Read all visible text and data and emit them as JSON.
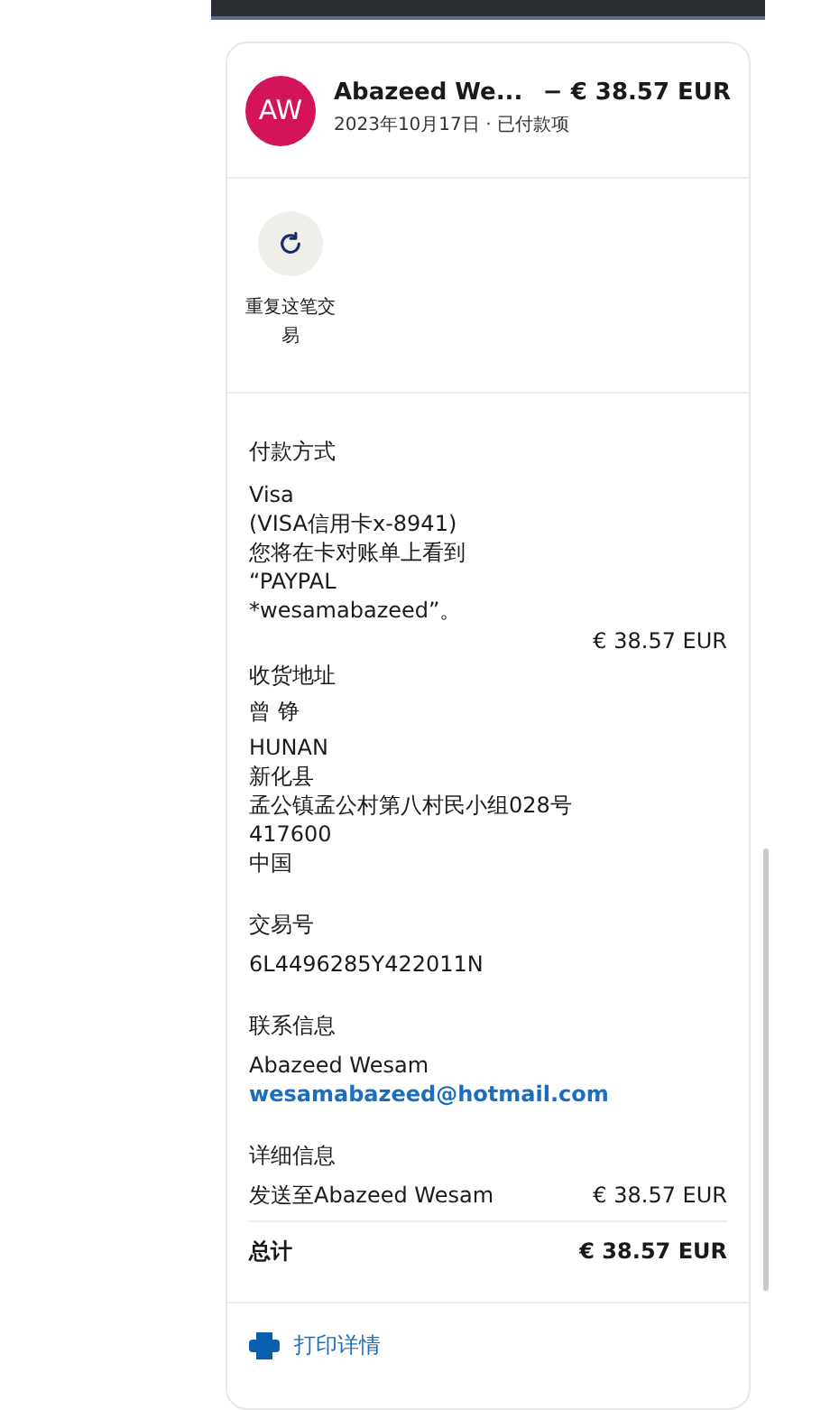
{
  "header": {
    "avatar_initials": "AW",
    "name": "Abazeed We...",
    "amount": "− € 38.57 EUR",
    "subtitle": "2023年10月17日 · 已付款项"
  },
  "actions": [
    {
      "label": "重复这笔交易"
    }
  ],
  "payment": {
    "heading": "付款方式",
    "lines": [
      "Visa",
      "(VISA信用卡x-8941)",
      "您将在卡对账单上看到",
      "“PAYPAL",
      "*wesamabazeed”。"
    ],
    "amount": "€ 38.57 EUR"
  },
  "shipping": {
    "heading": "收货地址",
    "name": "曾 铮",
    "lines": [
      "HUNAN",
      "新化县",
      "孟公镇孟公村第八村民小组028号",
      "417600",
      "中国"
    ]
  },
  "transaction": {
    "heading": "交易号",
    "id": "6L4496285Y422011N"
  },
  "contact": {
    "heading": "联系信息",
    "name": "Abazeed Wesam",
    "email": "wesamabazeed@hotmail.com"
  },
  "details": {
    "heading": "详细信息",
    "rows": [
      {
        "label": "发送至Abazeed Wesam",
        "amount": "€ 38.57 EUR"
      }
    ],
    "total_label": "总计",
    "total_amount": "€ 38.57 EUR"
  },
  "print_link": "打印详情"
}
